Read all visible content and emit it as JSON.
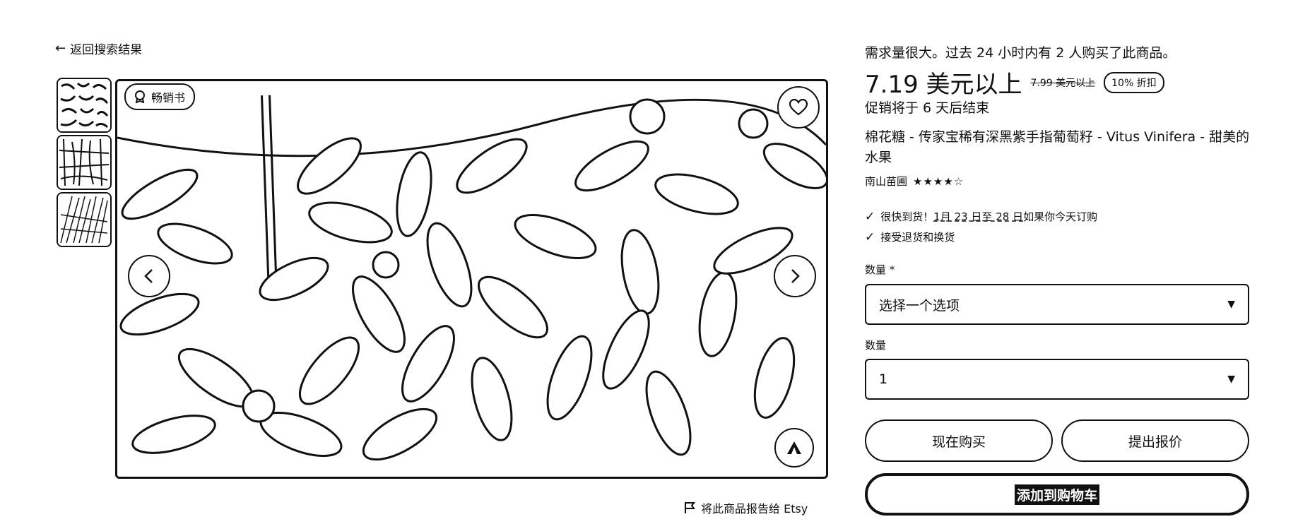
{
  "nav": {
    "back_arrow": "←",
    "back_label": "返回搜索结果"
  },
  "gallery": {
    "bestseller_label": "畅销书",
    "icons": [
      "bestseller-badge-icon",
      "heart-icon",
      "chevron-left-icon",
      "chevron-right-icon",
      "zoom-icon",
      "flag-icon"
    ]
  },
  "report": {
    "label": "将此商品报告给 Etsy"
  },
  "product": {
    "demand": "需求量很大。过去 24 小时内有 2 人购买了此商品。",
    "price": "7.19 美元以上",
    "old_price": "7.99 美元以上",
    "discount": "10% 折扣",
    "promo": "促销将于 6 天后结束",
    "title": "棉花糖 - 传家宝稀有深黑紫手指葡萄籽 - Vitus Vinifera - 甜美的水果",
    "shop_name": "南山苗圃",
    "stars": "★★★★☆",
    "rating": 4.5,
    "delivery_prefix": "很快到货！",
    "delivery_dates": "1月 23 日至 28 日",
    "delivery_suffix": "如果你今天订购",
    "returns": "接受退货和换货"
  },
  "form": {
    "option_label": "数量 *",
    "option_value": "选择一个选项",
    "quantity_label": "数量",
    "quantity_value": "1"
  },
  "actions": {
    "buy_now": "现在购买",
    "make_offer": "提出报价",
    "add_to_cart": "添加到购物车"
  },
  "symbols": {
    "check": "✓",
    "caret": "▼"
  }
}
